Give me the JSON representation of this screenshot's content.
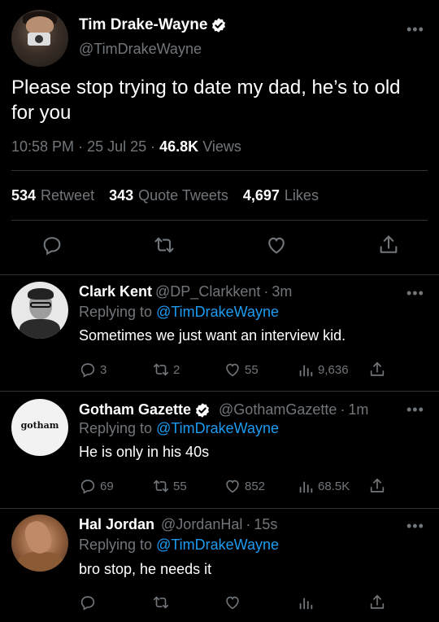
{
  "main": {
    "name": "Tim Drake-Wayne",
    "handle": "@TimDrakeWayne",
    "text": "Please stop trying to date my dad, he’s to old for you",
    "time": "10:58 PM",
    "date": "25 Jul 25",
    "views_count": "46.8K",
    "views_label": "Views",
    "retweets_count": "534",
    "retweets_label": "Retweet",
    "quotes_count": "343",
    "quotes_label": "Quote Tweets",
    "likes_count": "4,697",
    "likes_label": "Likes"
  },
  "replies": [
    {
      "name": "Clark Kent",
      "handle": "@DP_Clarkkent",
      "time": "3m",
      "replying_prefix": "Replying to",
      "replying_to": "@TimDrakeWayne",
      "text": "Sometimes we just want an interview kid.",
      "reply_count": "3",
      "retweet_count": "2",
      "like_count": "55",
      "views_count": "9,636"
    },
    {
      "name": "Gotham Gazette",
      "handle": "@GothamGazette",
      "time": "1m",
      "avatar_text": "gotham",
      "replying_prefix": "Replying to",
      "replying_to": "@TimDrakeWayne",
      "text": "He is only in his 40s",
      "reply_count": "69",
      "retweet_count": "55",
      "like_count": "852",
      "views_count": "68.5K"
    },
    {
      "name": "Hal Jordan",
      "handle": "@JordanHal",
      "time": "15s",
      "replying_prefix": "Replying to",
      "replying_to": "@TimDrakeWayne",
      "text": "bro stop, he needs it",
      "reply_count": "",
      "retweet_count": "",
      "like_count": "",
      "views_count": ""
    }
  ],
  "colors": {
    "background": "#000000",
    "text_primary": "#e7e9ea",
    "text_secondary": "#71767b",
    "link": "#1d9bf0",
    "divider": "#2f3336"
  },
  "icons": [
    "verified-badge-icon",
    "more-icon",
    "reply-icon",
    "retweet-icon",
    "like-icon",
    "share-icon",
    "views-icon"
  ]
}
